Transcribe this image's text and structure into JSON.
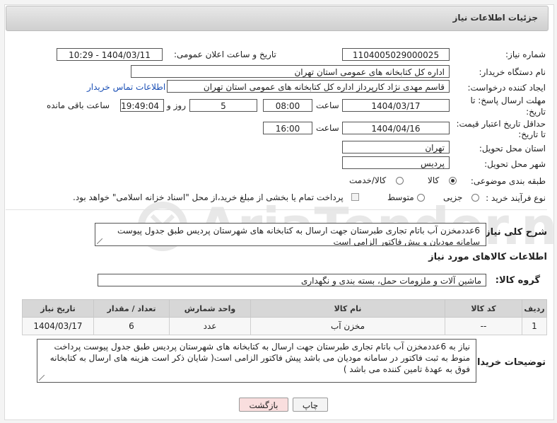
{
  "header": {
    "title": "جزئیات اطلاعات نیاز"
  },
  "fields": {
    "need_number_label": "شماره نیاز:",
    "need_number_value": "1104005029000025",
    "announce_label": "تاریخ و ساعت اعلان عمومی:",
    "announce_value": "1404/03/11 - 10:29",
    "buyer_org_label": "نام دستگاه خریدار:",
    "buyer_org_value": "اداره کل کتابخانه های عمومی استان تهران",
    "requester_label": "ایجاد کننده درخواست:",
    "requester_value": "قاسم مهدی نژاد کارپرداز اداره کل کتابخانه های عمومی استان تهران",
    "contact_link": "اطلاعات تماس خریدار",
    "deadline_label_1": "مهلت ارسال پاسخ: تا",
    "deadline_label_2": "تاریخ:",
    "deadline_date": "1404/03/17",
    "time_label": "ساعت",
    "deadline_time": "08:00",
    "days_value": "5",
    "days_label": "روز و",
    "remaining_time": "19:49:04",
    "remaining_label": "ساعت باقی مانده",
    "validity_label_1": "حداقل تاریخ اعتبار قیمت:",
    "validity_label_2": "تا تاریخ:",
    "validity_date": "1404/04/16",
    "validity_time_label": "ساعت",
    "validity_time": "16:00",
    "province_label": "استان محل تحویل:",
    "province_value": "تهران",
    "city_label": "شهر محل تحویل:",
    "city_value": "پردیس",
    "category_label": "طبقه بندی موضوعی:",
    "category_options": [
      "کالا",
      "کالا/خدمت"
    ],
    "process_label": "نوع فرآیند خرید :",
    "process_options": [
      "جزیی",
      "متوسط"
    ],
    "payment_note": "پرداخت تمام یا بخشی از مبلغ خرید،از محل \"اسناد خزانه اسلامی\" خواهد بود."
  },
  "summary": {
    "label": "شرح کلی نیاز:",
    "text": "6عددمخزن آب باتام تجاری طبرستان جهت ارسال به کتابخانه های شهرستان پردیس طبق جدول پیوست سامانه مودیان و پیش فاکتور الزامی است"
  },
  "goods": {
    "section_title": "اطلاعات کالاهای مورد نیاز",
    "group_label": "گروه کالا:",
    "group_value": "ماشین آلات و ملزومات حمل، بسته بندی و نگهداری",
    "columns": [
      "ردیف",
      "کد کالا",
      "نام کالا",
      "واحد شمارش",
      "تعداد / مقدار",
      "تاریخ نیاز"
    ],
    "rows": [
      {
        "row": "1",
        "code": "--",
        "name": "مخزن آب",
        "unit": "عدد",
        "qty": "6",
        "date": "1404/03/17"
      }
    ]
  },
  "buyer_notes": {
    "label": "توضیحات خریدار:",
    "text": "نیاز به 6عددمخزن آب باتام تجاری طبرستان جهت ارسال به کتابخانه های شهرستان پردیس طبق جدول پیوست پرداخت منوط به ثبت فاکتور در سامانه مودیان می باشد پیش فاکتور الزامی است( شایان ذکر است هزینه های ارسال به کتابخانه فوق به عهدهٔ تامین کننده می باشد )"
  },
  "buttons": {
    "print": "چاپ",
    "back": "بازگشت"
  },
  "watermark": {
    "text": "AriaTender.neT"
  },
  "colors": {
    "link": "#1a4fb5",
    "back_button_bg": "#f9dede",
    "table_header": "#d7d7d7"
  }
}
